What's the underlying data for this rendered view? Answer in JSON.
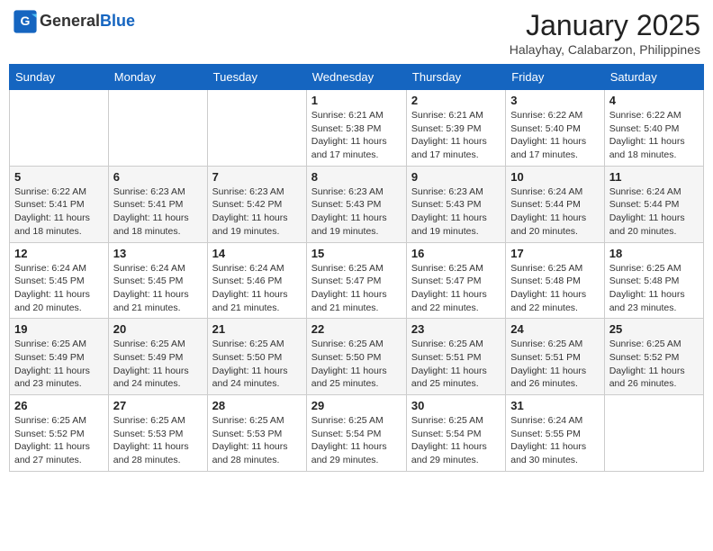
{
  "header": {
    "logo_general": "General",
    "logo_blue": "Blue",
    "month_title": "January 2025",
    "location": "Halayhay, Calabarzon, Philippines"
  },
  "weekdays": [
    "Sunday",
    "Monday",
    "Tuesday",
    "Wednesday",
    "Thursday",
    "Friday",
    "Saturday"
  ],
  "weeks": [
    [
      {
        "day": "",
        "sunrise": "",
        "sunset": "",
        "daylight": ""
      },
      {
        "day": "",
        "sunrise": "",
        "sunset": "",
        "daylight": ""
      },
      {
        "day": "",
        "sunrise": "",
        "sunset": "",
        "daylight": ""
      },
      {
        "day": "1",
        "sunrise": "Sunrise: 6:21 AM",
        "sunset": "Sunset: 5:38 PM",
        "daylight": "Daylight: 11 hours and 17 minutes."
      },
      {
        "day": "2",
        "sunrise": "Sunrise: 6:21 AM",
        "sunset": "Sunset: 5:39 PM",
        "daylight": "Daylight: 11 hours and 17 minutes."
      },
      {
        "day": "3",
        "sunrise": "Sunrise: 6:22 AM",
        "sunset": "Sunset: 5:40 PM",
        "daylight": "Daylight: 11 hours and 17 minutes."
      },
      {
        "day": "4",
        "sunrise": "Sunrise: 6:22 AM",
        "sunset": "Sunset: 5:40 PM",
        "daylight": "Daylight: 11 hours and 18 minutes."
      }
    ],
    [
      {
        "day": "5",
        "sunrise": "Sunrise: 6:22 AM",
        "sunset": "Sunset: 5:41 PM",
        "daylight": "Daylight: 11 hours and 18 minutes."
      },
      {
        "day": "6",
        "sunrise": "Sunrise: 6:23 AM",
        "sunset": "Sunset: 5:41 PM",
        "daylight": "Daylight: 11 hours and 18 minutes."
      },
      {
        "day": "7",
        "sunrise": "Sunrise: 6:23 AM",
        "sunset": "Sunset: 5:42 PM",
        "daylight": "Daylight: 11 hours and 19 minutes."
      },
      {
        "day": "8",
        "sunrise": "Sunrise: 6:23 AM",
        "sunset": "Sunset: 5:43 PM",
        "daylight": "Daylight: 11 hours and 19 minutes."
      },
      {
        "day": "9",
        "sunrise": "Sunrise: 6:23 AM",
        "sunset": "Sunset: 5:43 PM",
        "daylight": "Daylight: 11 hours and 19 minutes."
      },
      {
        "day": "10",
        "sunrise": "Sunrise: 6:24 AM",
        "sunset": "Sunset: 5:44 PM",
        "daylight": "Daylight: 11 hours and 20 minutes."
      },
      {
        "day": "11",
        "sunrise": "Sunrise: 6:24 AM",
        "sunset": "Sunset: 5:44 PM",
        "daylight": "Daylight: 11 hours and 20 minutes."
      }
    ],
    [
      {
        "day": "12",
        "sunrise": "Sunrise: 6:24 AM",
        "sunset": "Sunset: 5:45 PM",
        "daylight": "Daylight: 11 hours and 20 minutes."
      },
      {
        "day": "13",
        "sunrise": "Sunrise: 6:24 AM",
        "sunset": "Sunset: 5:45 PM",
        "daylight": "Daylight: 11 hours and 21 minutes."
      },
      {
        "day": "14",
        "sunrise": "Sunrise: 6:24 AM",
        "sunset": "Sunset: 5:46 PM",
        "daylight": "Daylight: 11 hours and 21 minutes."
      },
      {
        "day": "15",
        "sunrise": "Sunrise: 6:25 AM",
        "sunset": "Sunset: 5:47 PM",
        "daylight": "Daylight: 11 hours and 21 minutes."
      },
      {
        "day": "16",
        "sunrise": "Sunrise: 6:25 AM",
        "sunset": "Sunset: 5:47 PM",
        "daylight": "Daylight: 11 hours and 22 minutes."
      },
      {
        "day": "17",
        "sunrise": "Sunrise: 6:25 AM",
        "sunset": "Sunset: 5:48 PM",
        "daylight": "Daylight: 11 hours and 22 minutes."
      },
      {
        "day": "18",
        "sunrise": "Sunrise: 6:25 AM",
        "sunset": "Sunset: 5:48 PM",
        "daylight": "Daylight: 11 hours and 23 minutes."
      }
    ],
    [
      {
        "day": "19",
        "sunrise": "Sunrise: 6:25 AM",
        "sunset": "Sunset: 5:49 PM",
        "daylight": "Daylight: 11 hours and 23 minutes."
      },
      {
        "day": "20",
        "sunrise": "Sunrise: 6:25 AM",
        "sunset": "Sunset: 5:49 PM",
        "daylight": "Daylight: 11 hours and 24 minutes."
      },
      {
        "day": "21",
        "sunrise": "Sunrise: 6:25 AM",
        "sunset": "Sunset: 5:50 PM",
        "daylight": "Daylight: 11 hours and 24 minutes."
      },
      {
        "day": "22",
        "sunrise": "Sunrise: 6:25 AM",
        "sunset": "Sunset: 5:50 PM",
        "daylight": "Daylight: 11 hours and 25 minutes."
      },
      {
        "day": "23",
        "sunrise": "Sunrise: 6:25 AM",
        "sunset": "Sunset: 5:51 PM",
        "daylight": "Daylight: 11 hours and 25 minutes."
      },
      {
        "day": "24",
        "sunrise": "Sunrise: 6:25 AM",
        "sunset": "Sunset: 5:51 PM",
        "daylight": "Daylight: 11 hours and 26 minutes."
      },
      {
        "day": "25",
        "sunrise": "Sunrise: 6:25 AM",
        "sunset": "Sunset: 5:52 PM",
        "daylight": "Daylight: 11 hours and 26 minutes."
      }
    ],
    [
      {
        "day": "26",
        "sunrise": "Sunrise: 6:25 AM",
        "sunset": "Sunset: 5:52 PM",
        "daylight": "Daylight: 11 hours and 27 minutes."
      },
      {
        "day": "27",
        "sunrise": "Sunrise: 6:25 AM",
        "sunset": "Sunset: 5:53 PM",
        "daylight": "Daylight: 11 hours and 28 minutes."
      },
      {
        "day": "28",
        "sunrise": "Sunrise: 6:25 AM",
        "sunset": "Sunset: 5:53 PM",
        "daylight": "Daylight: 11 hours and 28 minutes."
      },
      {
        "day": "29",
        "sunrise": "Sunrise: 6:25 AM",
        "sunset": "Sunset: 5:54 PM",
        "daylight": "Daylight: 11 hours and 29 minutes."
      },
      {
        "day": "30",
        "sunrise": "Sunrise: 6:25 AM",
        "sunset": "Sunset: 5:54 PM",
        "daylight": "Daylight: 11 hours and 29 minutes."
      },
      {
        "day": "31",
        "sunrise": "Sunrise: 6:24 AM",
        "sunset": "Sunset: 5:55 PM",
        "daylight": "Daylight: 11 hours and 30 minutes."
      },
      {
        "day": "",
        "sunrise": "",
        "sunset": "",
        "daylight": ""
      }
    ]
  ]
}
